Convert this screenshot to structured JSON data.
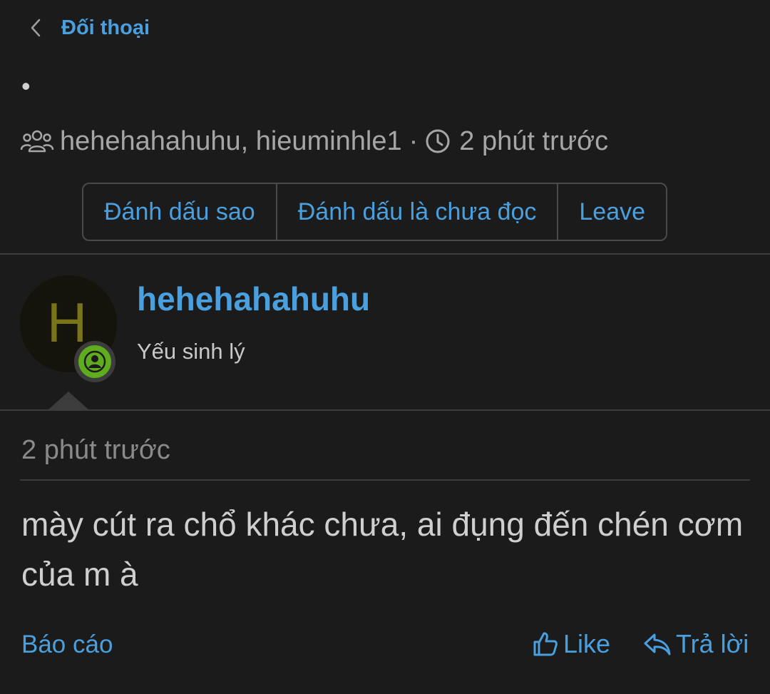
{
  "header": {
    "back_label": "Đối thoại"
  },
  "conversation": {
    "title": "•",
    "participants": "hehehahahuhu, hieuminhle1",
    "separator": "·",
    "time_ago": "2 phút trước"
  },
  "actions": {
    "star_label": "Đánh dấu sao",
    "mark_unread_label": "Đánh dấu là chưa đọc",
    "leave_label": "Leave"
  },
  "post": {
    "avatar_letter": "H",
    "username": "hehehahahuhu",
    "user_title": "Yếu sinh lý",
    "time": "2 phút trước",
    "message": "mày cút ra chổ khác chưa, ai đụng đến chén cơm của m à",
    "report_label": "Báo cáo",
    "like_label": "Like",
    "reply_label": "Trả lời"
  },
  "colors": {
    "background": "#1b1b1b",
    "accent": "#4a9fde",
    "online": "#5fad1e",
    "avatar_letter": "#7a7418"
  },
  "icons": {
    "back": "chevron-left-icon",
    "participants": "users-icon",
    "time": "clock-icon",
    "status": "user-online-icon",
    "like": "thumbs-up-icon",
    "reply": "reply-icon"
  }
}
